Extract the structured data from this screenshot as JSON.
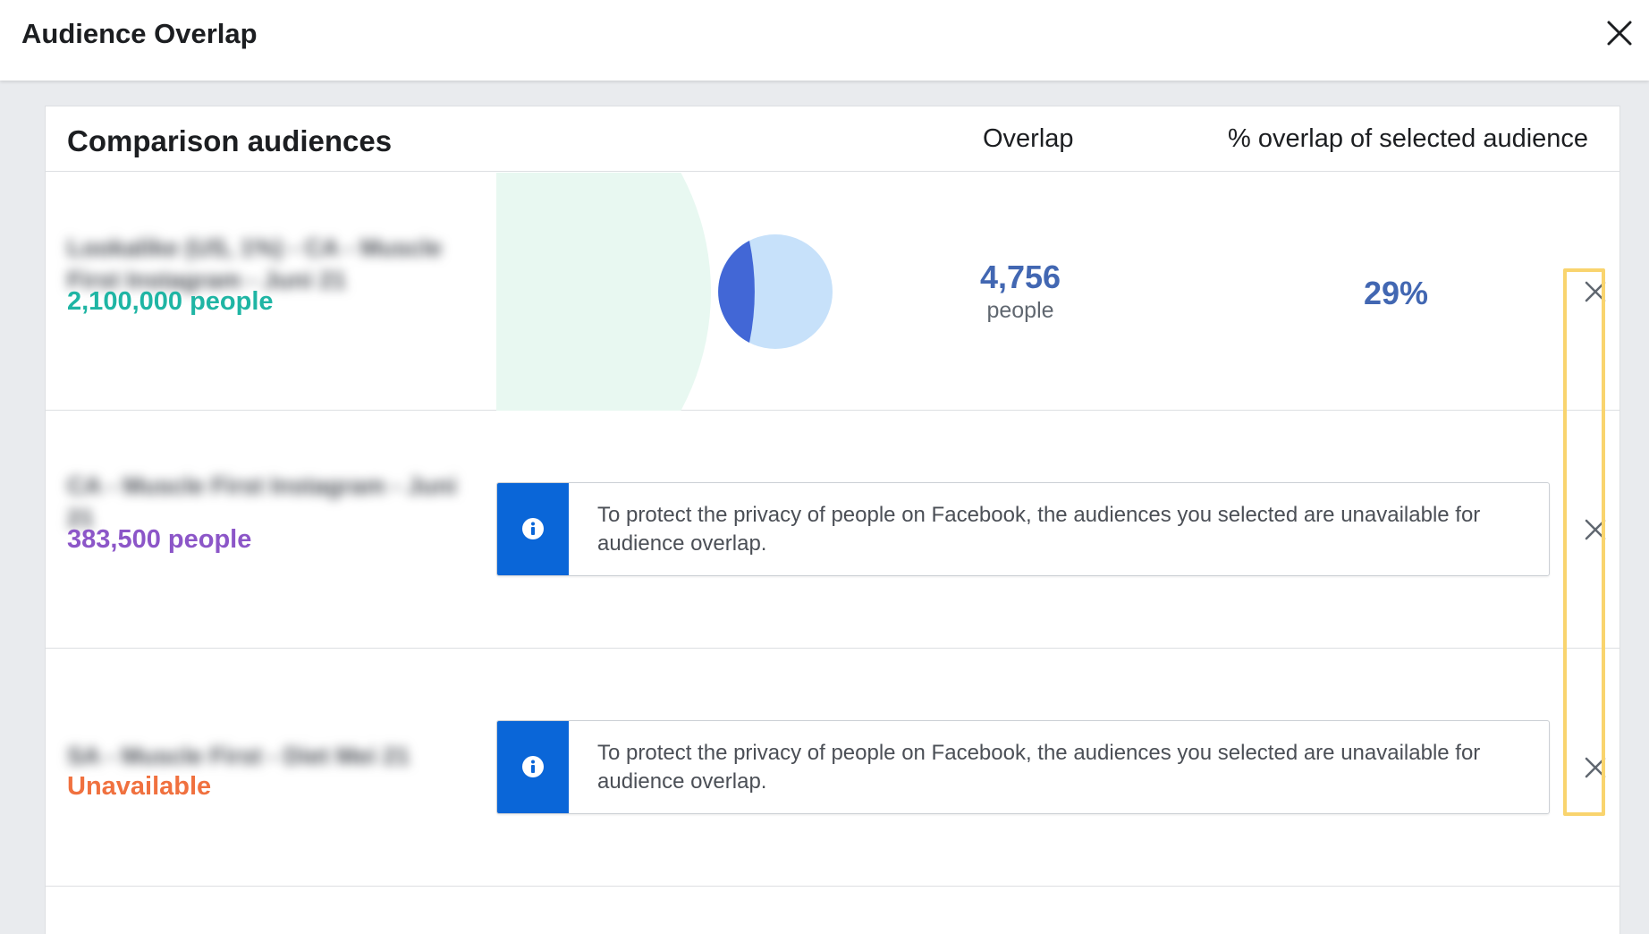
{
  "header": {
    "title": "Audience Overlap",
    "close_icon": "close-icon"
  },
  "table": {
    "title": "Comparison audiences",
    "overlap_header": "Overlap",
    "pct_header": "% overlap of selected audience"
  },
  "rows": [
    {
      "name": "Lookalike (US, 1%) - CA - Muscle First Instagram - Juni 21",
      "size": "2,100,000 people",
      "size_color": "#1fb5a4",
      "overlap_value": "4,756",
      "overlap_unit": "people",
      "overlap_pct": "29%",
      "overlap_share": 0.29
    },
    {
      "name": "CA - Muscle First Instagram - Juni 21",
      "size": "383,500 people",
      "size_color": "#8c56c8",
      "notice": "To protect the privacy of people on Facebook, the audiences you selected are unavailable for audience overlap."
    },
    {
      "name": "SA - Muscle First - Diet Mei 21",
      "size": "Unavailable",
      "size_color": "#f0713f",
      "notice": "To protect the privacy of people on Facebook, the audiences you selected are unavailable for audience overlap."
    }
  ],
  "colors": {
    "venn_large": "#e8f8f1",
    "venn_small": "#c7e1fa",
    "venn_overlap": "#4267d6",
    "notice_icon_bg": "#0a66d8",
    "highlight": "#f9d46e"
  },
  "icons": {
    "info": "info-icon",
    "remove": "close-icon"
  }
}
